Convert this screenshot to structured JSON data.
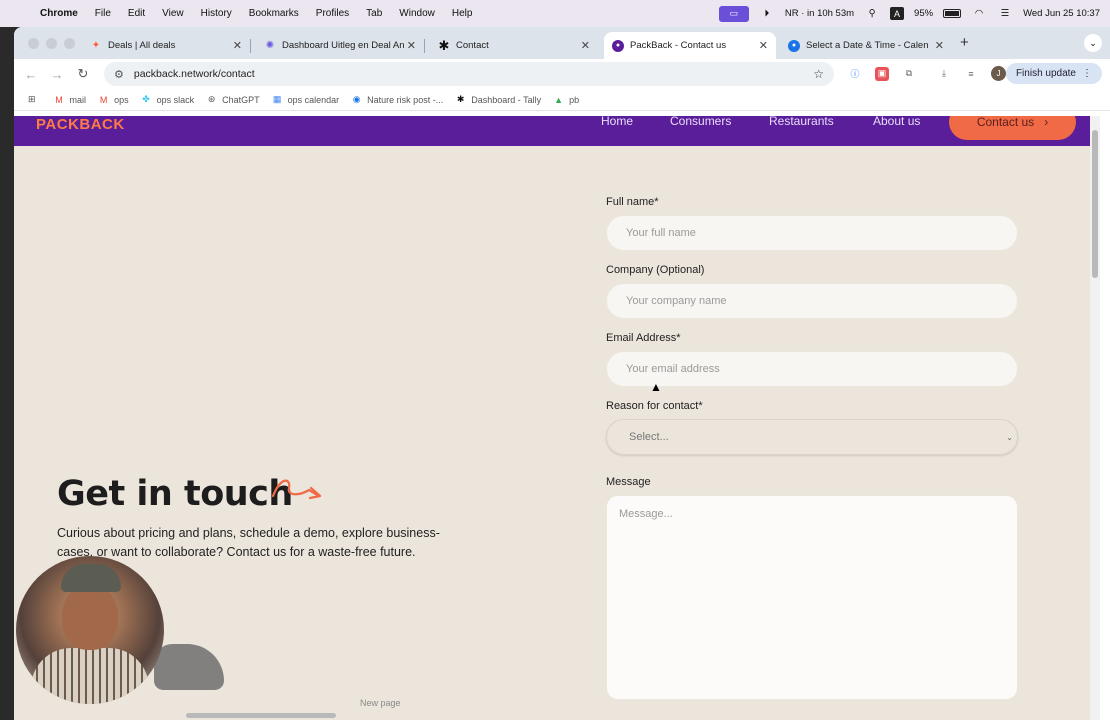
{
  "menubar": {
    "app": "Chrome",
    "items": [
      "File",
      "Edit",
      "View",
      "History",
      "Bookmarks",
      "Profiles",
      "Tab",
      "Window",
      "Help"
    ],
    "status": "NR · in 10h 53m",
    "keyboard": "A",
    "battery": "95%",
    "datetime": "Wed Jun 25  10:37"
  },
  "tabs": [
    {
      "title": "Deals | All deals",
      "icon": "hubspot-icon",
      "color": "#ff5c35"
    },
    {
      "title": "Dashboard Uitleg en Deal An",
      "icon": "gear-icon",
      "color": "#6b5be0"
    },
    {
      "title": "Contact",
      "icon": "asterisk-icon",
      "color": "#111111"
    },
    {
      "title": "PackBack - Contact us",
      "icon": "packback-icon",
      "color": "#5a1e9a"
    },
    {
      "title": "Select a Date & Time - Calen",
      "icon": "calendly-icon",
      "color": "#1a73e8"
    }
  ],
  "toolbar": {
    "url": "packback.network/contact",
    "finish_update": "Finish update",
    "profile_initial": "J"
  },
  "bookmarks": [
    "mail",
    "ops",
    "ops slack",
    "ChatGPT",
    "ops calendar",
    "Nature risk post -...",
    "Dashboard - Tally",
    "pb"
  ],
  "site": {
    "logo": "PACKBACK",
    "nav": [
      "Home",
      "Consumers",
      "Restaurants",
      "About us"
    ],
    "contact_button": "Contact us"
  },
  "hero": {
    "heading": "Get in touch",
    "subtext": "Curious about pricing and plans, schedule a demo, explore business-cases, or want to collaborate? Contact us for a waste-free future."
  },
  "form": {
    "full_name_label": "Full name*",
    "full_name_placeholder": "Your full name",
    "company_label": "Company (Optional)",
    "company_placeholder": "Your company name",
    "email_label": "Email Address*",
    "email_placeholder": "Your email address",
    "reason_label": "Reason for contact*",
    "reason_selected": "Select...",
    "message_label": "Message",
    "message_placeholder": "Message..."
  },
  "bottom_hint": "New page",
  "colors": {
    "brand_purple": "#5a1e9a",
    "brand_orange": "#ef6a45",
    "page_bg": "#ebe5dc"
  }
}
